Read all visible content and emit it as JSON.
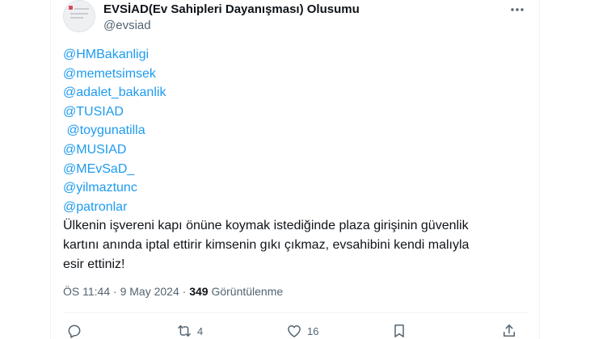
{
  "author": {
    "display_name": "EVSİAD(Ev Sahipleri Dayanışması) Olusumu",
    "handle": "@evsiad"
  },
  "tweet": {
    "mentions": [
      "@HMBakanligi",
      "@memetsimsek",
      "@adalet_bakanlik",
      "@TUSIAD",
      " @toygunatilla",
      "@MUSIAD",
      "@MEvSaD_",
      "@yilmaztunc",
      "@patronlar"
    ],
    "body_lines": [
      "Ülkenin işvereni kapı önüne koymak istediğinde plaza girişinin güvenlik",
      "kartını anında iptal ettirir kimsenin gıkı çıkmaz, evsahibini kendi malıyla",
      "esir ettiniz!"
    ]
  },
  "meta": {
    "time": "ÖS 11:44",
    "separator": "·",
    "date": "9 May 2024",
    "views_count": "349",
    "views_label": "Görüntülenme"
  },
  "actions": {
    "reply_count": "",
    "retweet_count": "4",
    "like_count": "16"
  },
  "icons": {
    "more": "more-horizontal-icon",
    "reply": "reply-icon",
    "retweet": "retweet-icon",
    "like": "heart-icon",
    "bookmark": "bookmark-icon",
    "share": "share-icon"
  },
  "colors": {
    "link": "#1d9bf0",
    "text": "#0f1419",
    "secondary": "#536471"
  }
}
